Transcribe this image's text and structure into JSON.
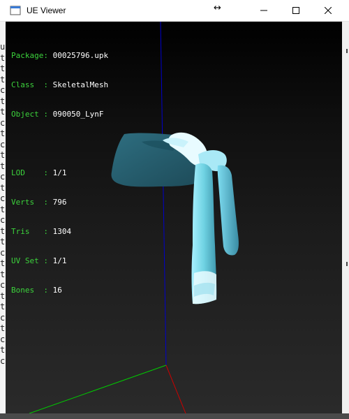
{
  "window": {
    "title": "UE Viewer",
    "controls": {
      "minimize": "minimize",
      "maximize": "maximize",
      "close": "close"
    }
  },
  "info": {
    "package": {
      "label": "Package:",
      "value": "00025796.upk"
    },
    "class": {
      "label": "Class  :",
      "value": "SkeletalMesh"
    },
    "object": {
      "label": "Object :",
      "value": "090050_LynF"
    },
    "lod": {
      "label": "LOD    :",
      "value": "1/1"
    },
    "verts": {
      "label": "Verts  :",
      "value": "796"
    },
    "tris": {
      "label": "Tris   :",
      "value": "1304"
    },
    "uvset": {
      "label": "UV Set :",
      "value": "1/1"
    },
    "bones": {
      "label": "Bones  :",
      "value": "16"
    }
  },
  "background_left_chars": [
    "u",
    "t",
    "t",
    "t",
    "c",
    "t",
    "t",
    "c",
    "t",
    "c",
    "t",
    "t",
    "c",
    "t",
    "c",
    "t",
    "c",
    "t",
    "t",
    "c",
    "t",
    "t",
    "c",
    "t",
    "t",
    "c",
    "t",
    "c",
    "t",
    "c"
  ],
  "colors": {
    "label": "#3cd23c",
    "value": "#ffffff",
    "axis_x": "#00cc00",
    "axis_y": "#cc0000",
    "axis_z": "#0000cc",
    "mesh": "#7fd6e0"
  },
  "icons": [
    "app-icon",
    "minimize-icon",
    "maximize-icon",
    "close-icon",
    "resize-cursor-icon"
  ]
}
